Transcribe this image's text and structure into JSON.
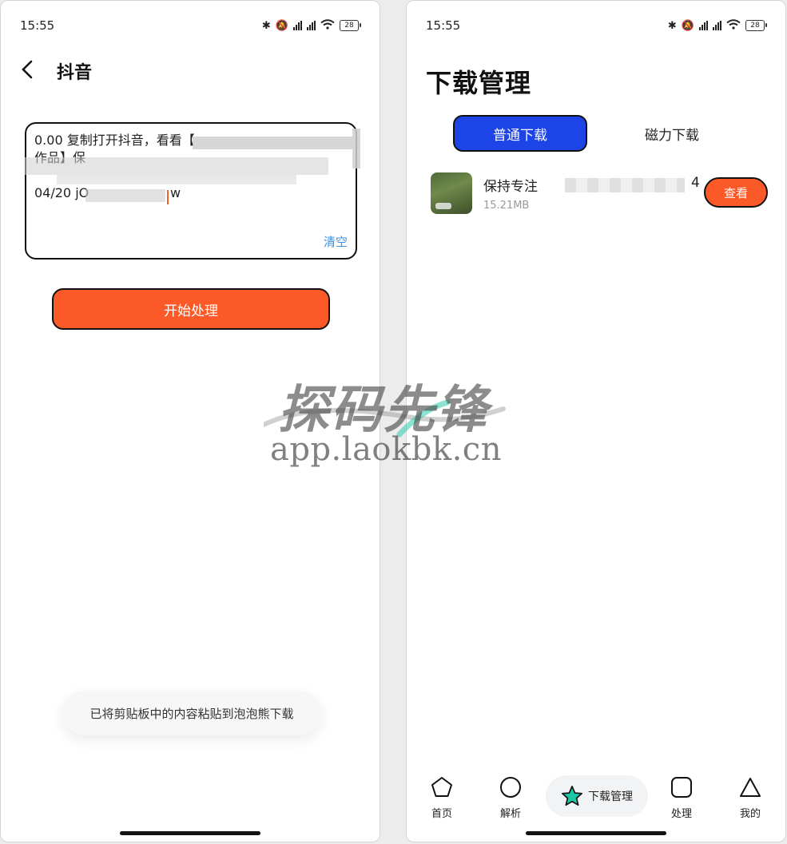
{
  "status_bar": {
    "time": "15:55",
    "battery": "28"
  },
  "left_screen": {
    "title": "抖音",
    "input_text": "0.00 复制打开抖音，看看【\n作品】保\n\n04/20 jO                    w",
    "clear_label": "清空",
    "start_button": "开始处理",
    "toast": "已将剪贴板中的内容粘贴到泡泡熊下载"
  },
  "right_screen": {
    "title": "下载管理",
    "tabs": {
      "normal": "普通下载",
      "magnet": "磁力下载"
    },
    "download_item": {
      "name": "保持专注",
      "name_tail": "4",
      "size": "15.21MB",
      "view_label": "查看"
    },
    "nav": {
      "home": "首页",
      "parse": "解析",
      "downloads": "下载管理",
      "process": "处理",
      "mine": "我的"
    }
  },
  "watermark": {
    "title": "探码先锋",
    "url": "app.laokbk.cn"
  },
  "colors": {
    "accent_orange": "#fb5a28",
    "accent_blue": "#1c44e6",
    "link_blue": "#3a8fe0",
    "star_teal": "#1cc7a8"
  }
}
